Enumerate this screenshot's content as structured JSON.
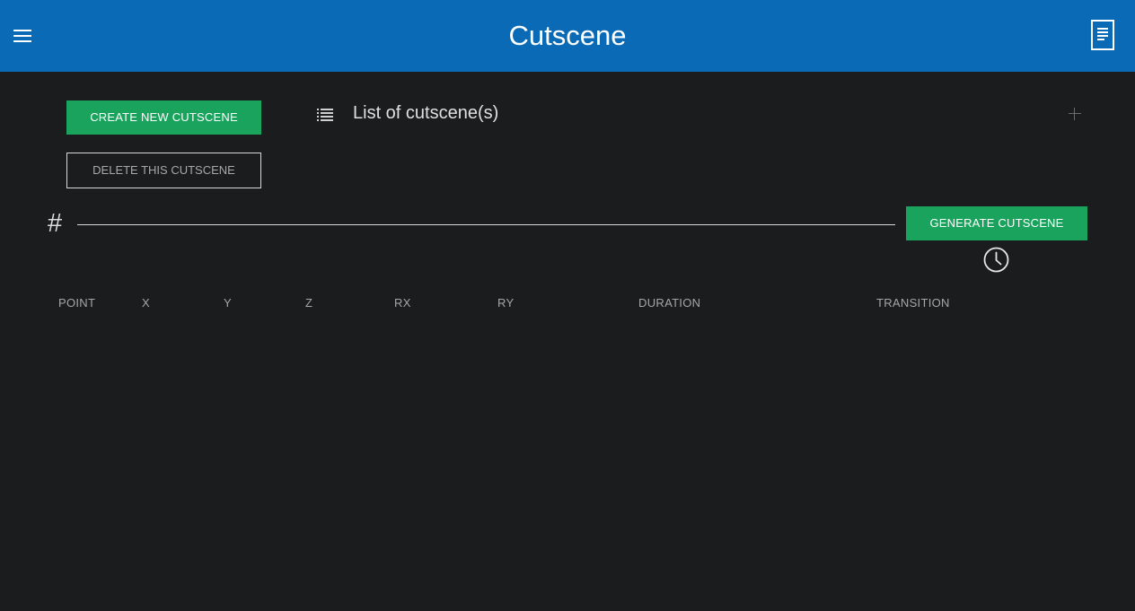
{
  "header": {
    "title": "Cutscene",
    "menu_icon": "hamburger-menu-icon",
    "doc_icon": "document-icon",
    "bar_color": "#0a6ab5"
  },
  "actions": {
    "create_label": "CREATE NEW CUTSCENE",
    "delete_label": "DELETE THIS CUTSCENE",
    "generate_label": "GENERATE CUTSCENE",
    "accent_color": "#1aa35c"
  },
  "list": {
    "icon": "list-icon",
    "title": "List of cutscene(s)",
    "add_icon": "plus-icon"
  },
  "name_field": {
    "prefix": "#",
    "value": "",
    "placeholder": ""
  },
  "timing": {
    "icon": "clock-icon"
  },
  "table": {
    "columns": [
      "POINT",
      "X",
      "Y",
      "Z",
      "RX",
      "RY",
      "DURATION",
      "TRANSITION"
    ],
    "rows": []
  }
}
